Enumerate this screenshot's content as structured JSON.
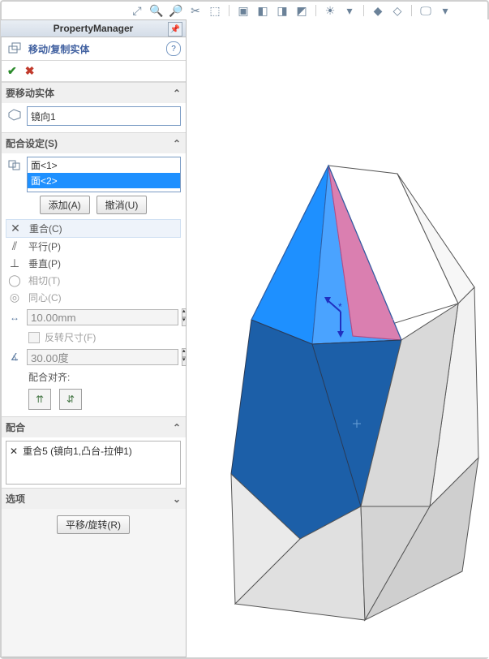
{
  "pm": {
    "title": "PropertyManager"
  },
  "cmd": {
    "title": "移动/复制实体"
  },
  "sec_move": {
    "title": "要移动实体",
    "item": "镜向1"
  },
  "sec_mate_set": {
    "title": "配合设定(S)",
    "items": [
      "面<1>",
      "面<2>"
    ],
    "add_btn": "添加(A)",
    "undo_btn": "撤消(U)"
  },
  "mate_types": {
    "coincident": "重合(C)",
    "parallel": "平行(P)",
    "perpendicular": "垂直(P)",
    "tangent": "相切(T)",
    "concentric": "同心(C)"
  },
  "distance": {
    "value": "10.00mm",
    "reverse": "反转尺寸(F)"
  },
  "angle": {
    "value": "30.00度"
  },
  "align": {
    "label": "配合对齐:"
  },
  "sec_mates": {
    "title": "配合",
    "item": "重合5 (镜向1,凸台-拉伸1)"
  },
  "sec_options": {
    "title": "选项"
  },
  "bottom_btn": "平移/旋转(R)"
}
